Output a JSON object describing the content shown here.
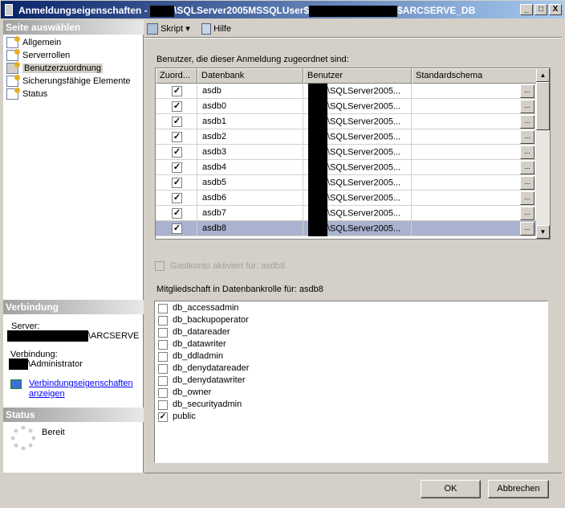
{
  "window": {
    "title_prefix": "Anmeldungseigenschaften - ",
    "title_mid": "\\SQLServer2005MSSQLUser$",
    "title_suffix": "$ARCSERVE_DB",
    "min": "_",
    "max": "□",
    "close": "X"
  },
  "sidebar": {
    "header": "Seite auswählen",
    "items": [
      {
        "label": "Allgemein"
      },
      {
        "label": "Serverrollen"
      },
      {
        "label": "Benutzerzuordnung"
      },
      {
        "label": "Sicherungsfähige Elemente"
      },
      {
        "label": "Status"
      }
    ]
  },
  "connection": {
    "header": "Verbindung",
    "server_label": "Server:",
    "server_value": "\\ARCSERVE",
    "conn_label": "Verbindung:",
    "conn_value": "\\Administrator",
    "link": "Verbindungseigenschaften anzeigen"
  },
  "status": {
    "header": "Status",
    "value": "Bereit"
  },
  "toolbar": {
    "script": "Skript",
    "help": "Hilfe"
  },
  "mapping": {
    "label": "Benutzer, die dieser Anmeldung zugeordnet sind:",
    "columns": [
      "Zuord...",
      "Datenbank",
      "Benutzer",
      "Standardschema"
    ],
    "rows": [
      {
        "checked": true,
        "db": "asdb",
        "user": "\\SQLServer2005...",
        "schema": ""
      },
      {
        "checked": true,
        "db": "asdb0",
        "user": "\\SQLServer2005...",
        "schema": ""
      },
      {
        "checked": true,
        "db": "asdb1",
        "user": "\\SQLServer2005...",
        "schema": ""
      },
      {
        "checked": true,
        "db": "asdb2",
        "user": "\\SQLServer2005...",
        "schema": ""
      },
      {
        "checked": true,
        "db": "asdb3",
        "user": "\\SQLServer2005...",
        "schema": ""
      },
      {
        "checked": true,
        "db": "asdb4",
        "user": "\\SQLServer2005...",
        "schema": ""
      },
      {
        "checked": true,
        "db": "asdb5",
        "user": "\\SQLServer2005...",
        "schema": ""
      },
      {
        "checked": true,
        "db": "asdb6",
        "user": "\\SQLServer2005...",
        "schema": ""
      },
      {
        "checked": true,
        "db": "asdb7",
        "user": "\\SQLServer2005...",
        "schema": ""
      },
      {
        "checked": true,
        "db": "asdb8",
        "user": "\\SQLServer2005...",
        "schema": "",
        "selected": true
      }
    ],
    "ellipsis": "..."
  },
  "guest": {
    "label": "Gastkonto aktiviert für: asdb8",
    "checked": false
  },
  "roles": {
    "label": "Mitgliedschaft in Datenbankrolle für: asdb8",
    "items": [
      {
        "name": "db_accessadmin",
        "checked": false
      },
      {
        "name": "db_backupoperator",
        "checked": false
      },
      {
        "name": "db_datareader",
        "checked": false
      },
      {
        "name": "db_datawriter",
        "checked": false
      },
      {
        "name": "db_ddladmin",
        "checked": false
      },
      {
        "name": "db_denydatareader",
        "checked": false
      },
      {
        "name": "db_denydatawriter",
        "checked": false
      },
      {
        "name": "db_owner",
        "checked": false
      },
      {
        "name": "db_securityadmin",
        "checked": false
      },
      {
        "name": "public",
        "checked": true
      }
    ]
  },
  "buttons": {
    "ok": "OK",
    "cancel": "Abbrechen"
  }
}
